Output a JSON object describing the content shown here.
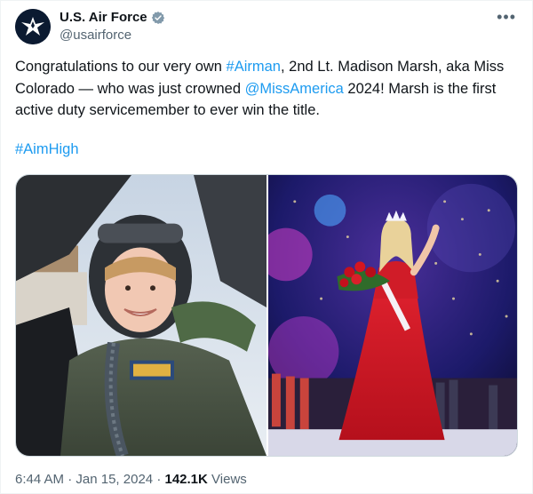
{
  "account": {
    "display_name": "U.S. Air Force",
    "handle": "@usairforce",
    "avatar_icon": "air-force-emblem-icon",
    "verified_icon": "verified-badge-icon",
    "verified_color": "#829aab"
  },
  "tweet": {
    "text_1": "Congratulations to our very own ",
    "hashtag_airman": "#Airman",
    "text_2": ", 2nd Lt. Madison Marsh, aka Miss Colorado — who was just crowned ",
    "mention": "@MissAmerica",
    "text_3": " 2024! Marsh is the first active duty servicemember to ever win the title.",
    "hashtag_aimhigh": "#AimHigh"
  },
  "media": {
    "photos": [
      {
        "subject": "pilot in flight helmet beside fighter jet"
      },
      {
        "subject": "Miss America crowned on stage in red gown holding roses"
      }
    ]
  },
  "meta": {
    "time": "6:44 AM",
    "separator": "·",
    "date": "Jan 15, 2024",
    "views_count": "142.1K",
    "views_label": "Views"
  },
  "colors": {
    "link": "#1d9bf0",
    "secondary_text": "#536471",
    "primary_text": "#0f1419"
  }
}
